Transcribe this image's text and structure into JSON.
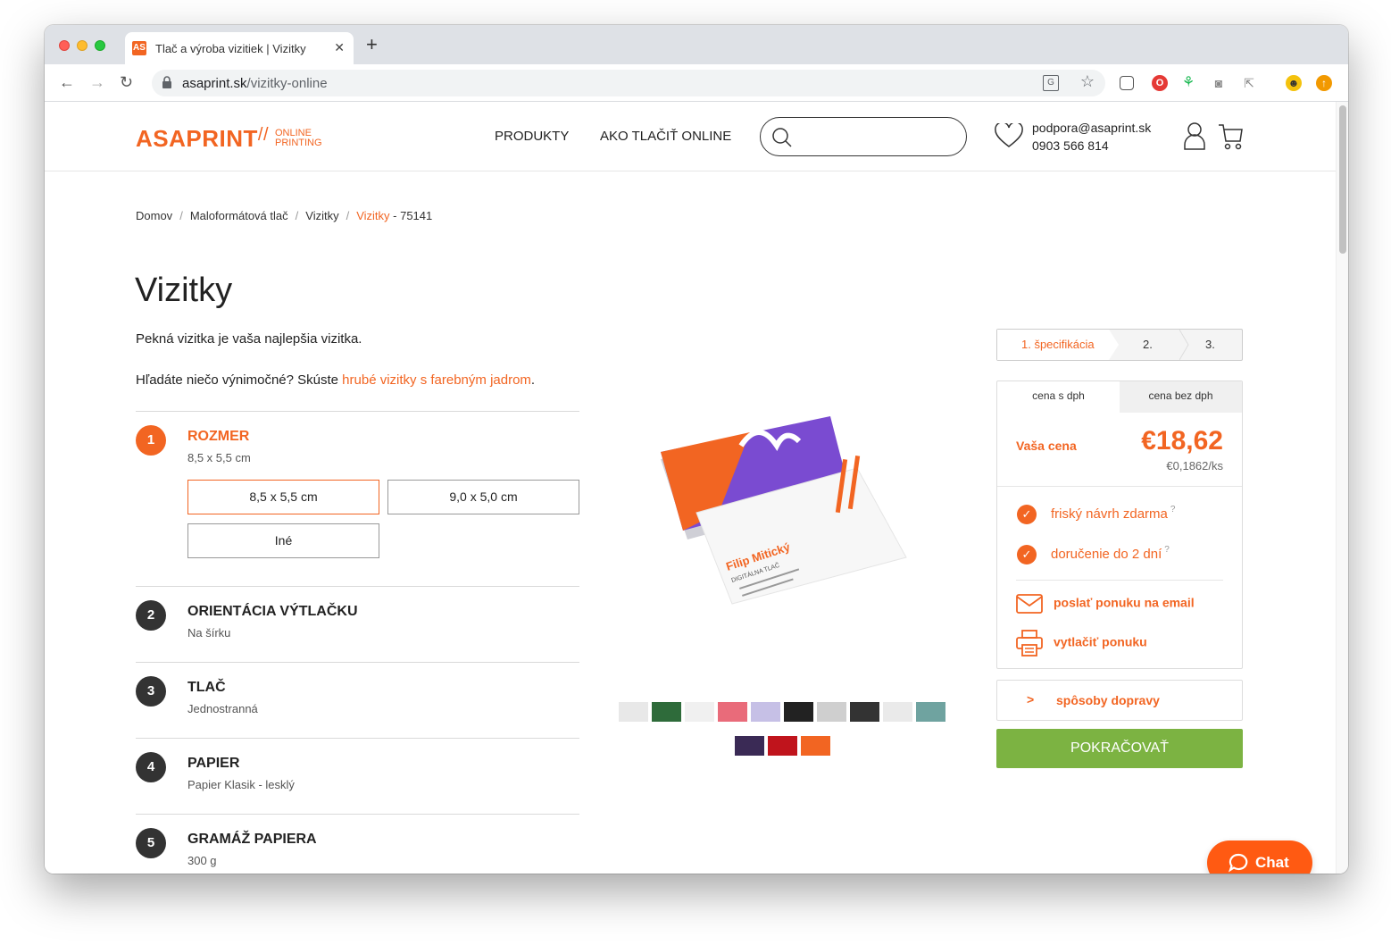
{
  "browser": {
    "tab_title": "Tlač a výroba vizitiek | Vizitky",
    "tab_favicon": "AS",
    "url_host": "asaprint.sk",
    "url_path": "/vizitky-online"
  },
  "header": {
    "logo": "ASAPRINT",
    "logo_slashes": "//",
    "logo_sub1": "ONLINE",
    "logo_sub2": "PRINTING",
    "nav": [
      "PRODUKTY",
      "AKO TLAČIŤ ONLINE"
    ],
    "support_email": "podpora@asaprint.sk",
    "support_phone": "0903 566 814"
  },
  "breadcrumb": {
    "items": [
      "Domov",
      "Maloformátová tlač",
      "Vizitky"
    ],
    "active": "Vizitky",
    "code": " - 75141"
  },
  "product": {
    "title": "Vizitky",
    "intro": "Pekná vizitka je vaša najlepšia vizitka.",
    "intro2_pre": "Hľadáte niečo výnimočné? Skúste ",
    "intro2_link": "hrubé vizitky s farebným jadrom",
    "intro2_post": "."
  },
  "steps": [
    {
      "num": "1",
      "title": "ROZMER",
      "value": "8,5 x 5,5 cm"
    },
    {
      "num": "2",
      "title": "ORIENTÁCIA VÝTLAČKU",
      "value": "Na šírku"
    },
    {
      "num": "3",
      "title": "TLAČ",
      "value": "Jednostranná"
    },
    {
      "num": "4",
      "title": "PAPIER",
      "value": "Papier Klasik - lesklý"
    },
    {
      "num": "5",
      "title": "GRAMÁŽ PAPIERA",
      "value": "300 g"
    }
  ],
  "size_options": [
    "8,5 x 5,5 cm",
    "9,0 x 5,0 cm",
    "Iné"
  ],
  "card_image": {
    "name": "Filip Mitický",
    "subtitle": "DIGITÁLNA TLAČ"
  },
  "wizard": [
    "1. špecifikácia",
    "2.",
    "3."
  ],
  "price": {
    "tab_with_vat": "cena s dph",
    "tab_without_vat": "cena bez dph",
    "label": "Vaša cena",
    "total": "€18,62",
    "unit": "€0,1862/ks"
  },
  "features": [
    "friský návrh zdarma",
    "doručenie do 2 dní"
  ],
  "feature_help": "?",
  "actions": {
    "email": "poslať ponuku na email",
    "print": "vytlačiť ponuku"
  },
  "shipping": "spôsoby dopravy",
  "continue": "POKRAČOVAŤ",
  "chat": "Chat",
  "colors": {
    "accent": "#f26522",
    "continue_green": "#7cb342",
    "chat_orange": "#ff5a12"
  }
}
